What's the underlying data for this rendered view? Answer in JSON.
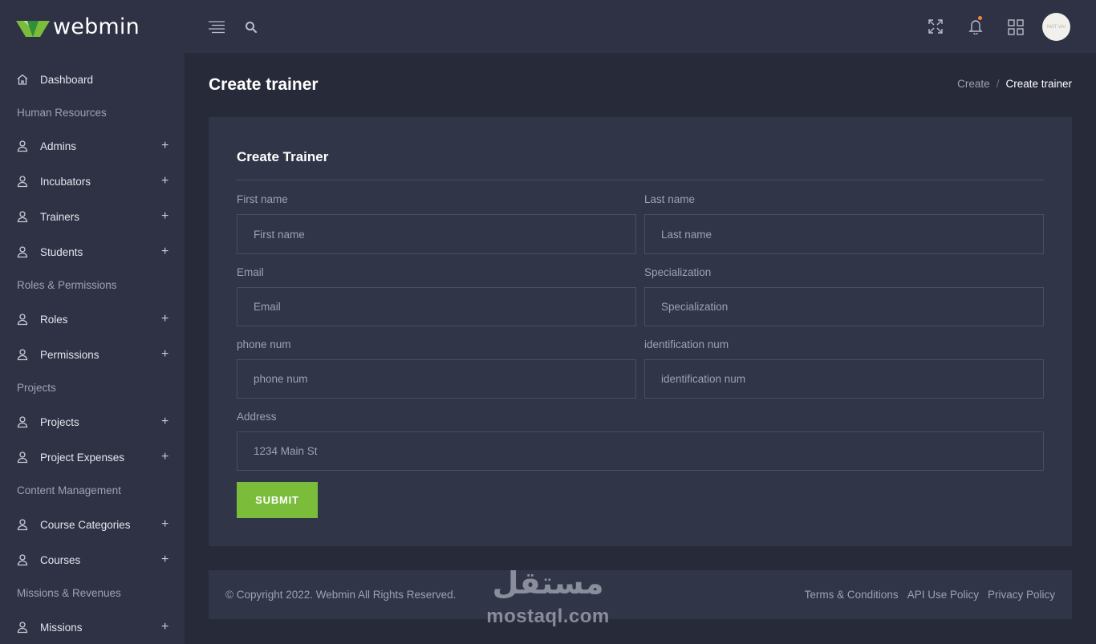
{
  "brand": {
    "name": "webmin",
    "logo_colors": [
      "#7bbd3b",
      "#2f8f3a"
    ]
  },
  "topbar": {
    "icons": [
      "menu-icon",
      "search-icon",
      "fullscreen-icon",
      "bell-icon",
      "grid-icon"
    ],
    "avatar_text": "MAT VAI"
  },
  "sidebar": {
    "dashboard": "Dashboard",
    "sections": [
      {
        "title": "Human Resources",
        "items": [
          "Admins",
          "Incubators",
          "Trainers",
          "Students"
        ]
      },
      {
        "title": "Roles & Permissions",
        "items": [
          "Roles",
          "Permissions"
        ]
      },
      {
        "title": "Projects",
        "items": [
          "Projects",
          "Project Expenses"
        ]
      },
      {
        "title": "Content Management",
        "items": [
          "Course Categories",
          "Courses"
        ]
      },
      {
        "title": "Missions & Revenues",
        "items": [
          "Missions"
        ]
      }
    ],
    "plus": "+"
  },
  "page": {
    "title": "Create trainer"
  },
  "breadcrumb": {
    "parent": "Create",
    "separator": "/",
    "current": "Create trainer"
  },
  "form": {
    "title": "Create Trainer",
    "fields": {
      "first_name": {
        "label": "First name",
        "placeholder": "First name"
      },
      "last_name": {
        "label": "Last name",
        "placeholder": "Last name"
      },
      "email": {
        "label": "Email",
        "placeholder": "Email"
      },
      "specialization": {
        "label": "Specialization",
        "placeholder": "Specialization"
      },
      "phone": {
        "label": "phone num",
        "placeholder": "phone num"
      },
      "identification": {
        "label": "identification num",
        "placeholder": "identification num"
      },
      "address": {
        "label": "Address",
        "placeholder": "1234 Main St"
      }
    },
    "submit_label": "SUBMIT"
  },
  "footer": {
    "copyright": "© Copyright 2022. Webmin All Rights Reserved.",
    "links": [
      "Terms & Conditions",
      "API Use Policy",
      "Privacy Policy"
    ]
  },
  "watermark": {
    "arabic": "مستقل",
    "latin": "mostaql.com"
  },
  "colors": {
    "accent": "#7bbd3b",
    "notification": "#f08a33"
  }
}
